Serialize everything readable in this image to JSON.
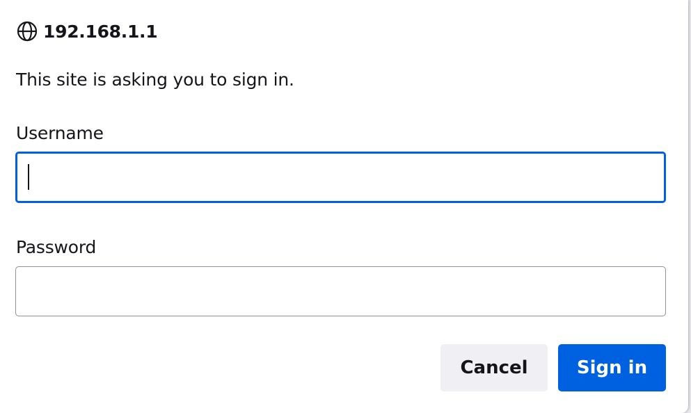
{
  "dialog": {
    "host": "192.168.1.1",
    "host_icon": "globe-icon",
    "message": "This site is asking you to sign in."
  },
  "form": {
    "username_label": "Username",
    "username_value": "",
    "password_label": "Password",
    "password_value": ""
  },
  "buttons": {
    "cancel_label": "Cancel",
    "signin_label": "Sign in"
  },
  "colors": {
    "accent": "#0060df",
    "primary_button": "#0061e0",
    "secondary_button": "#f0f0f4",
    "text": "#15141a"
  }
}
